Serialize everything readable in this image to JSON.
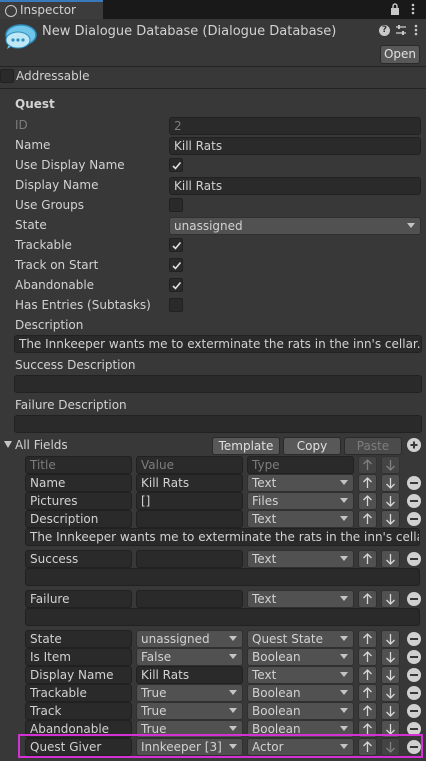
{
  "window": {
    "tab_label": "Inspector",
    "title": "New Dialogue Database (Dialogue Database)",
    "open_label": "Open"
  },
  "addressable": {
    "label": "Addressable",
    "checked": false
  },
  "quest": {
    "section_label": "Quest",
    "rows": [
      {
        "label": "ID",
        "kind": "text",
        "value": "2",
        "disabled": true
      },
      {
        "label": "Name",
        "kind": "text",
        "value": "Kill Rats"
      },
      {
        "label": "Use Display Name",
        "kind": "check",
        "checked": true
      },
      {
        "label": "Display Name",
        "kind": "text",
        "value": "Kill Rats"
      },
      {
        "label": "Use Groups",
        "kind": "check",
        "checked": false
      },
      {
        "label": "State",
        "kind": "popup",
        "value": "unassigned"
      },
      {
        "label": "Trackable",
        "kind": "check",
        "checked": true
      },
      {
        "label": "Track on Start",
        "kind": "check",
        "checked": true
      },
      {
        "label": "Abandonable",
        "kind": "check",
        "checked": true
      },
      {
        "label": "Has Entries (Subtasks)",
        "kind": "check",
        "checked": false
      }
    ],
    "description_label": "Description",
    "description_value": "The Innkeeper wants me to exterminate the rats in the inn's cellar.",
    "success_label": "Success Description",
    "success_value": "",
    "failure_label": "Failure Description",
    "failure_value": ""
  },
  "all_fields": {
    "label": "All Fields",
    "template_label": "Template",
    "copy_label": "Copy",
    "paste_label": "Paste",
    "header": {
      "title": "Title",
      "value": "Value",
      "type": "Type"
    },
    "fields": [
      {
        "title": "Name",
        "value": "Kill Rats",
        "value_kind": "text",
        "type": "Text",
        "up_enabled": true,
        "down_enabled": true
      },
      {
        "title": "Pictures",
        "value": "[]",
        "value_kind": "text",
        "type": "Files",
        "up_enabled": true,
        "down_enabled": true
      },
      {
        "title": "Description",
        "value": "",
        "value_kind": "text",
        "type": "Text",
        "up_enabled": true,
        "down_enabled": true,
        "long_text": "The Innkeeper wants me to exterminate the rats in the inn's cellar."
      },
      {
        "title": "Success",
        "value": "",
        "value_kind": "text",
        "type": "Text",
        "up_enabled": true,
        "down_enabled": true,
        "long_text": ""
      },
      {
        "title": "Failure",
        "value": "",
        "value_kind": "text",
        "type": "Text",
        "up_enabled": true,
        "down_enabled": true,
        "long_text": ""
      },
      {
        "title": "State",
        "value": "unassigned",
        "value_kind": "popup",
        "type": "Quest State",
        "up_enabled": true,
        "down_enabled": true
      },
      {
        "title": "Is Item",
        "value": "False",
        "value_kind": "popup",
        "type": "Boolean",
        "up_enabled": true,
        "down_enabled": true
      },
      {
        "title": "Display Name",
        "value": "Kill Rats",
        "value_kind": "text",
        "type": "Text",
        "up_enabled": true,
        "down_enabled": true
      },
      {
        "title": "Trackable",
        "value": "True",
        "value_kind": "popup",
        "type": "Boolean",
        "up_enabled": true,
        "down_enabled": true
      },
      {
        "title": "Track",
        "value": "True",
        "value_kind": "popup",
        "type": "Boolean",
        "up_enabled": true,
        "down_enabled": true
      },
      {
        "title": "Abandonable",
        "value": "True",
        "value_kind": "popup",
        "type": "Boolean",
        "up_enabled": true,
        "down_enabled": true
      },
      {
        "title": "Quest Giver",
        "value": "Innkeeper [3]",
        "value_kind": "popup",
        "type": "Actor",
        "up_enabled": true,
        "down_enabled": false,
        "highlighted": true
      }
    ]
  },
  "colors": {
    "background": "#383838",
    "highlight": "#d431d4",
    "accent": "#3a79bb"
  }
}
